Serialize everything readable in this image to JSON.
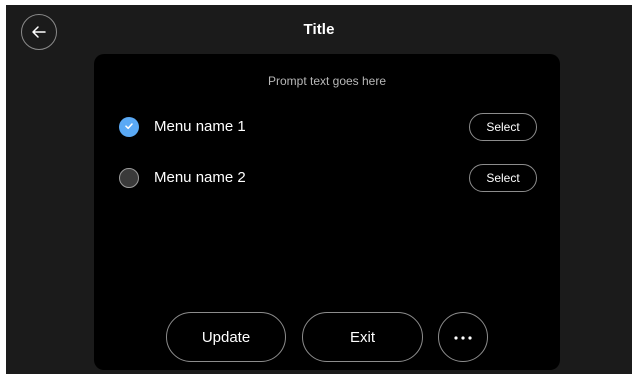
{
  "header": {
    "title": "Title",
    "back_icon": "arrow-left-icon"
  },
  "panel": {
    "prompt": "Prompt text goes here",
    "menu_items": [
      {
        "label": "Menu name 1",
        "selected": true,
        "button_label": "Select"
      },
      {
        "label": "Menu name 2",
        "selected": false,
        "button_label": "Select"
      }
    ]
  },
  "footer": {
    "update_label": "Update",
    "exit_label": "Exit",
    "more_icon": "more-horizontal-icon"
  },
  "colors": {
    "accent": "#5aa9f5",
    "background": "#1b1b1b",
    "panel": "#000000"
  }
}
